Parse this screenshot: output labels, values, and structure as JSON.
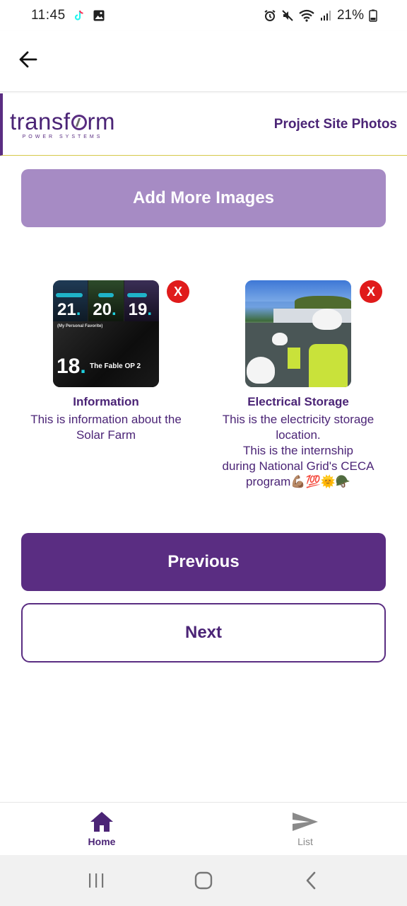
{
  "status_bar": {
    "time": "11:45",
    "battery": "21%"
  },
  "header": {
    "logo_text_before": "transf",
    "logo_text_after": "rm",
    "logo_subtext": "POWER SYSTEMS",
    "page_title": "Project Site Photos"
  },
  "actions": {
    "add_images": "Add More Images",
    "previous": "Previous",
    "next": "Next",
    "remove_label": "X"
  },
  "images": [
    {
      "title": "Information",
      "description": "This is information about the\nSolar Farm",
      "thumb_text": {
        "n1": "21",
        "n2": "20",
        "n3": "19",
        "small": "(My Personal Favorite)",
        "big": "18",
        "fable": "The Fable OP 2"
      }
    },
    {
      "title": "Electrical Storage",
      "description": "This is the electricity storage\nlocation.\nThis is the internship\nduring National Grid's CECA\nprogram💪🏽💯🌞🪖"
    }
  ],
  "bottom_nav": {
    "home": "Home",
    "list": "List"
  },
  "colors": {
    "brand_purple": "#5a2d82",
    "light_purple": "#a68bc4",
    "remove_red": "#e01b1b"
  }
}
